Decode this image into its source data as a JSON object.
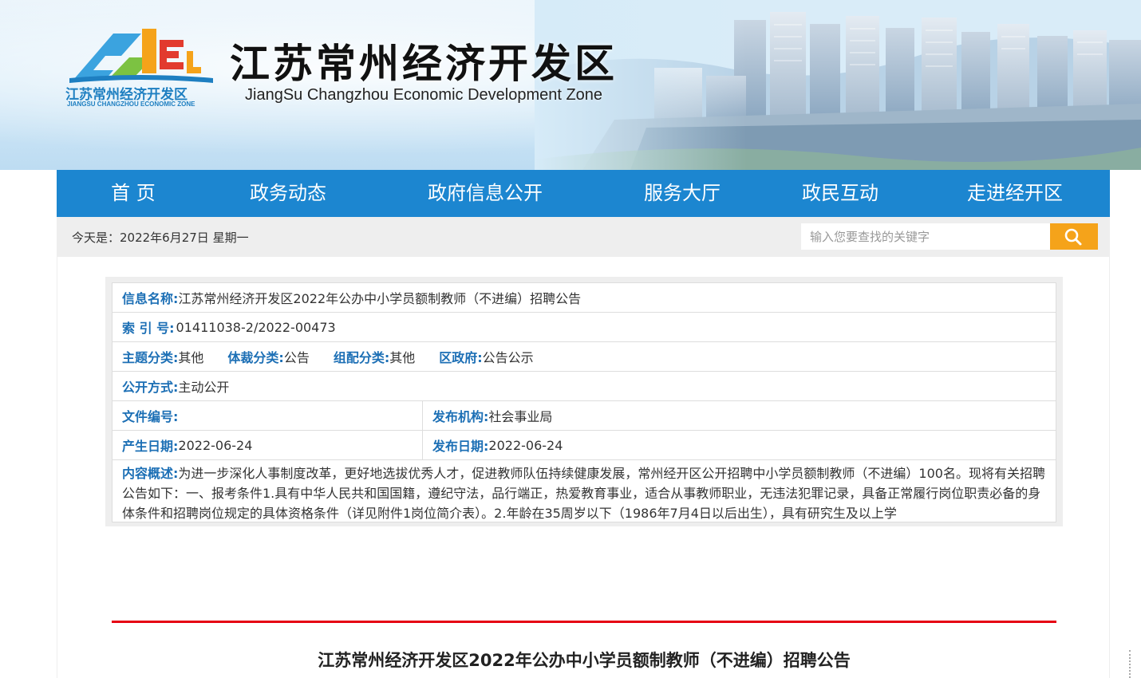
{
  "header": {
    "logo_cn": "江苏常州经济开发区",
    "logo_en": "JIANGSU CHANGZHOU ECONOMIC ZONE",
    "title": "江苏常州经济开发区",
    "subtitle": "JiangSu Changzhou Economic Development Zone"
  },
  "nav": {
    "items": [
      {
        "label": "首 页"
      },
      {
        "label": "政务动态"
      },
      {
        "label": "政府信息公开"
      },
      {
        "label": "服务大厅"
      },
      {
        "label": "政民互动"
      },
      {
        "label": "走进经开区"
      }
    ]
  },
  "infobar": {
    "date": "今天是：2022年6月27日 星期一",
    "search_placeholder": "输入您要查找的关键字"
  },
  "meta": {
    "name_label": "信息名称:",
    "name_value": "江苏常州经济开发区2022年公办中小学员额制教师（不进编）招聘公告",
    "index_label": "索 引 号:",
    "index_value": "01411038-2/2022-00473",
    "topic_label": "主题分类:",
    "topic_value": "其他",
    "genre_label": "体裁分类:",
    "genre_value": "公告",
    "org_cat_label": "组配分类:",
    "org_cat_value": "其他",
    "district_label": "区政府:",
    "district_value": "公告公示",
    "disclosure_label": "公开方式:",
    "disclosure_value": "主动公开",
    "doc_no_label": "文件编号:",
    "doc_no_value": "",
    "publisher_label": "发布机构:",
    "publisher_value": "社会事业局",
    "created_label": "产生日期:",
    "created_value": "2022-06-24",
    "published_label": "发布日期:",
    "published_value": "2022-06-24",
    "summary_label": "内容概述:",
    "summary_value": "为进一步深化人事制度改革，更好地选拔优秀人才，促进教师队伍持续健康发展，常州经开区公开招聘中小学员额制教师（不进编）100名。现将有关招聘公告如下：一、报考条件1.具有中华人民共和国国籍，遵纪守法，品行端正，热爱教育事业，适合从事教师职业，无违法犯罪记录，具备正常履行岗位职责必备的身体条件和招聘岗位规定的具体资格条件（详见附件1岗位简介表）。2.年龄在35周岁以下（1986年7月4日以后出生），具有研究生及以上学"
  },
  "article": {
    "title": "江苏常州经济开发区2022年公办中小学员额制教师（不进编）招聘公告"
  },
  "colors": {
    "nav_bg": "#1c86d0",
    "label_blue": "#1c6fb5",
    "search_btn": "#f5a31a",
    "red_rule": "#e60012"
  }
}
